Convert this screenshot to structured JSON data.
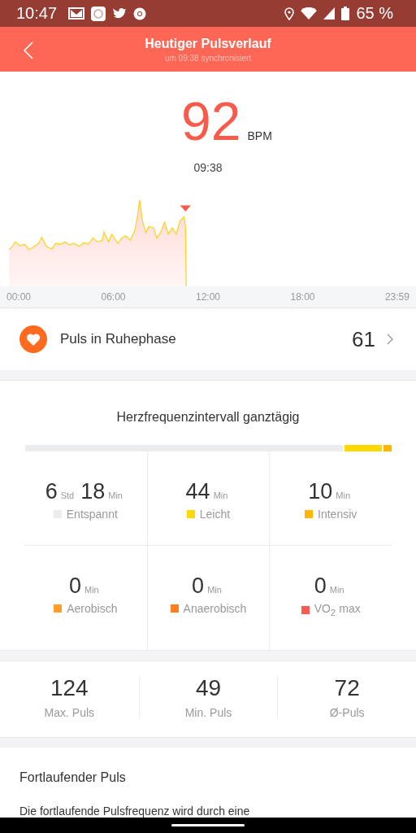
{
  "status_bar": {
    "time": "10:47",
    "battery": "65 %"
  },
  "header": {
    "title": "Heutiger Pulsverlauf",
    "subtitle": "um 09:38 synchronisiert"
  },
  "current": {
    "value": "92",
    "unit": "BPM",
    "time": "09:38"
  },
  "chart": {
    "kind": "picture",
    "x_labels": [
      "00:00",
      "06:00",
      "12:00",
      "18:00",
      "23:59"
    ]
  },
  "resting": {
    "label": "Puls in Ruhephase",
    "value": "61"
  },
  "zones": {
    "title": "Herzfrequenzintervall ganztägig",
    "items": [
      {
        "label": "Entspannt",
        "color": "#ebecee",
        "parts": [
          {
            "number": "6",
            "unit": "Std"
          },
          {
            "number": "18",
            "unit": "Min"
          }
        ]
      },
      {
        "label": "Leicht",
        "color": "#ffd800",
        "parts": [
          {
            "number": "44",
            "unit": "Min"
          }
        ]
      },
      {
        "label": "Intensiv",
        "color": "#ffb700",
        "parts": [
          {
            "number": "10",
            "unit": "Min"
          }
        ]
      },
      {
        "label": "Aerobisch",
        "color": "#ff9c2a",
        "parts": [
          {
            "number": "0",
            "unit": "Min"
          }
        ]
      },
      {
        "label": "Anaerobisch",
        "color": "#ff7f1f",
        "parts": [
          {
            "number": "0",
            "unit": "Min"
          }
        ]
      },
      {
        "label": "VO$_{2}$ max",
        "color": "#fb5a4e",
        "parts": [
          {
            "number": "0",
            "unit": "Min"
          }
        ]
      }
    ]
  },
  "stats": [
    {
      "value": "124",
      "label": "Max. Puls"
    },
    {
      "value": "49",
      "label": "Min. Puls"
    },
    {
      "value": "72",
      "label": "Ø-Puls"
    }
  ],
  "info": {
    "title": "Fortlaufender Puls",
    "text": "Die fortlaufende Pulsfrequenz wird durch eine"
  }
}
